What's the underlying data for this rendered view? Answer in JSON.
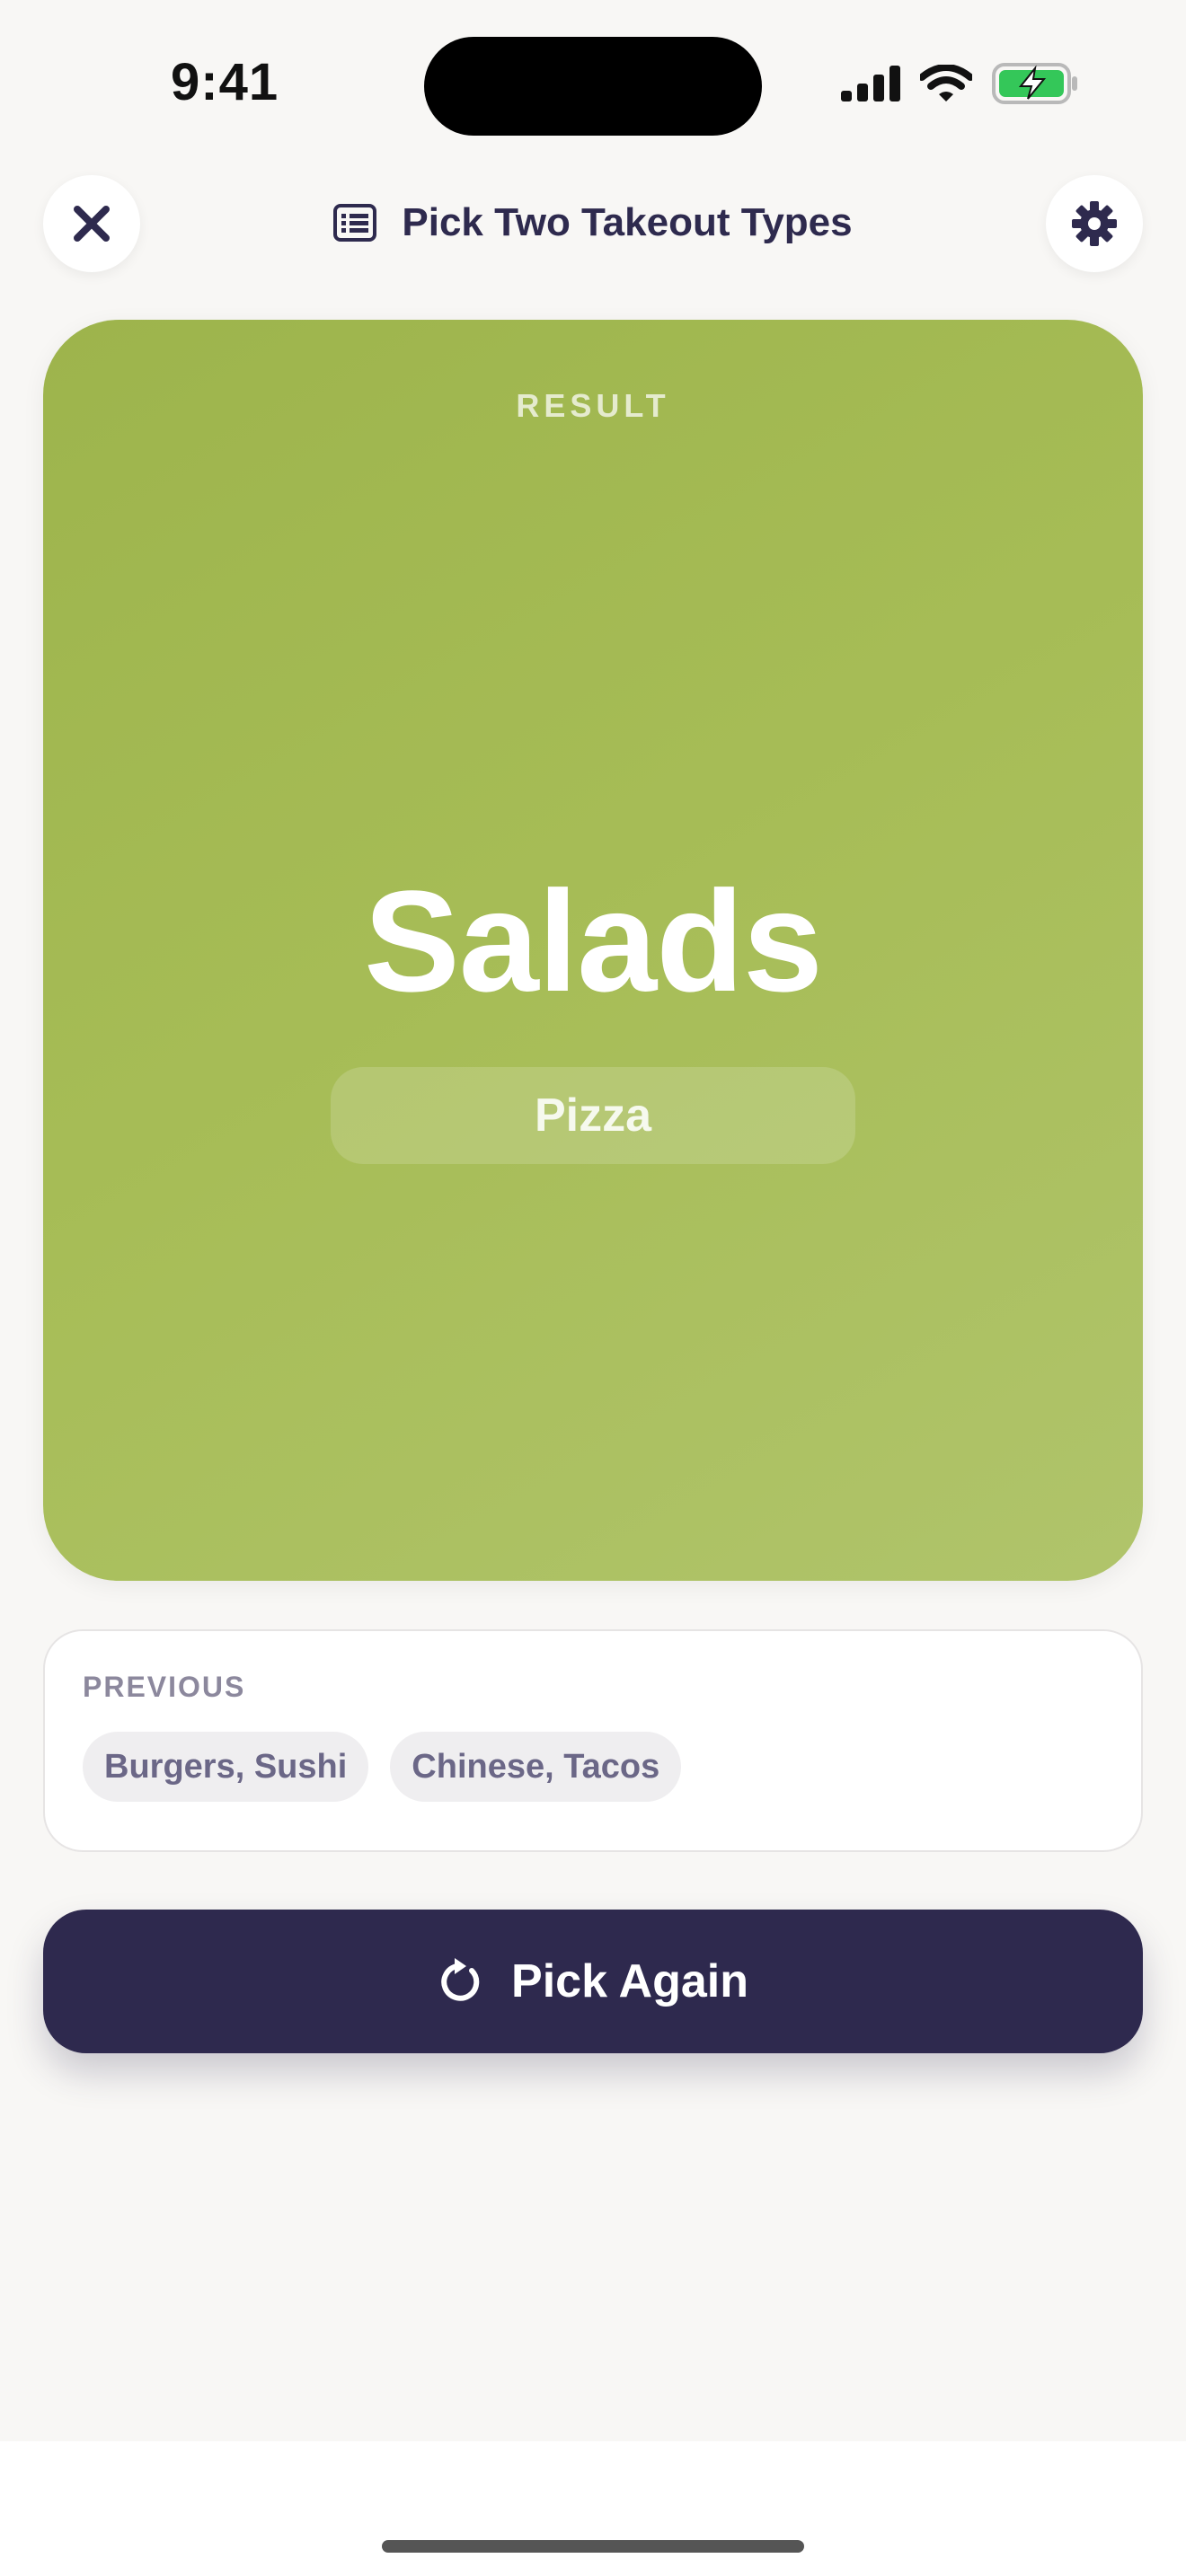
{
  "status_bar": {
    "time": "9:41"
  },
  "header": {
    "title": "Pick Two Takeout Types",
    "title_icon": "list-icon",
    "close_icon": "close-icon",
    "settings_icon": "gear-icon"
  },
  "result": {
    "label": "RESULT",
    "primary": "Salads",
    "secondary": "Pizza"
  },
  "previous": {
    "label": "PREVIOUS",
    "items": [
      "Burgers, Sushi",
      "Chinese, Tacos"
    ]
  },
  "action": {
    "label": "Pick Again",
    "icon": "refresh-icon"
  },
  "colors": {
    "card_green": "#a7bd57",
    "button_dark": "#2e294e",
    "background": "#f8f7f5"
  }
}
